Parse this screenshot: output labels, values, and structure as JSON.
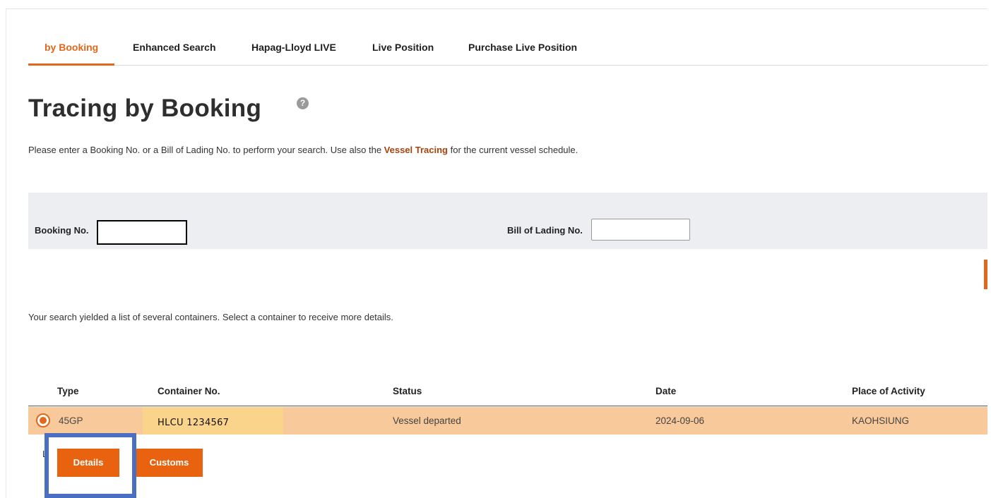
{
  "tabs": [
    {
      "label": "by Booking",
      "active": true
    },
    {
      "label": "Enhanced Search",
      "active": false
    },
    {
      "label": "Hapag-Lloyd LIVE",
      "active": false
    },
    {
      "label": "Live Position",
      "active": false
    },
    {
      "label": "Purchase Live Position",
      "active": false
    }
  ],
  "page": {
    "title": "Tracing by Booking",
    "help_icon": "question-circle-icon",
    "help_glyph": "?",
    "intro_before": "Please enter a Booking No. or a Bill of Lading No. to perform your search. Use also the ",
    "intro_link": "Vessel Tracing",
    "intro_after": " for the current vessel schedule."
  },
  "search": {
    "booking_label": "Booking No.",
    "booking_value": "",
    "bol_label": "Bill of Lading No.",
    "bol_value": ""
  },
  "results": {
    "message": "Your search yielded a list of several containers. Select a container to receive more details.",
    "columns": [
      "Type",
      "Container No.",
      "Status",
      "Date",
      "Place of Activity"
    ],
    "rows": [
      {
        "selected": true,
        "type": "45GP",
        "container_no": "HLCU 1234567",
        "status": "Vessel departed",
        "date": "2024-09-06",
        "place": "KAOHSIUNG"
      }
    ]
  },
  "actions": {
    "stub_letter": "L",
    "details_label": "Details",
    "customs_label": "Customs"
  },
  "colors": {
    "accent": "#e2671a",
    "button": "#e8620f",
    "selected_row": "#f8c99a",
    "container_highlight": "#fad48a",
    "annotation_box": "#4a6fc2",
    "panel_bg": "#eceef1"
  }
}
